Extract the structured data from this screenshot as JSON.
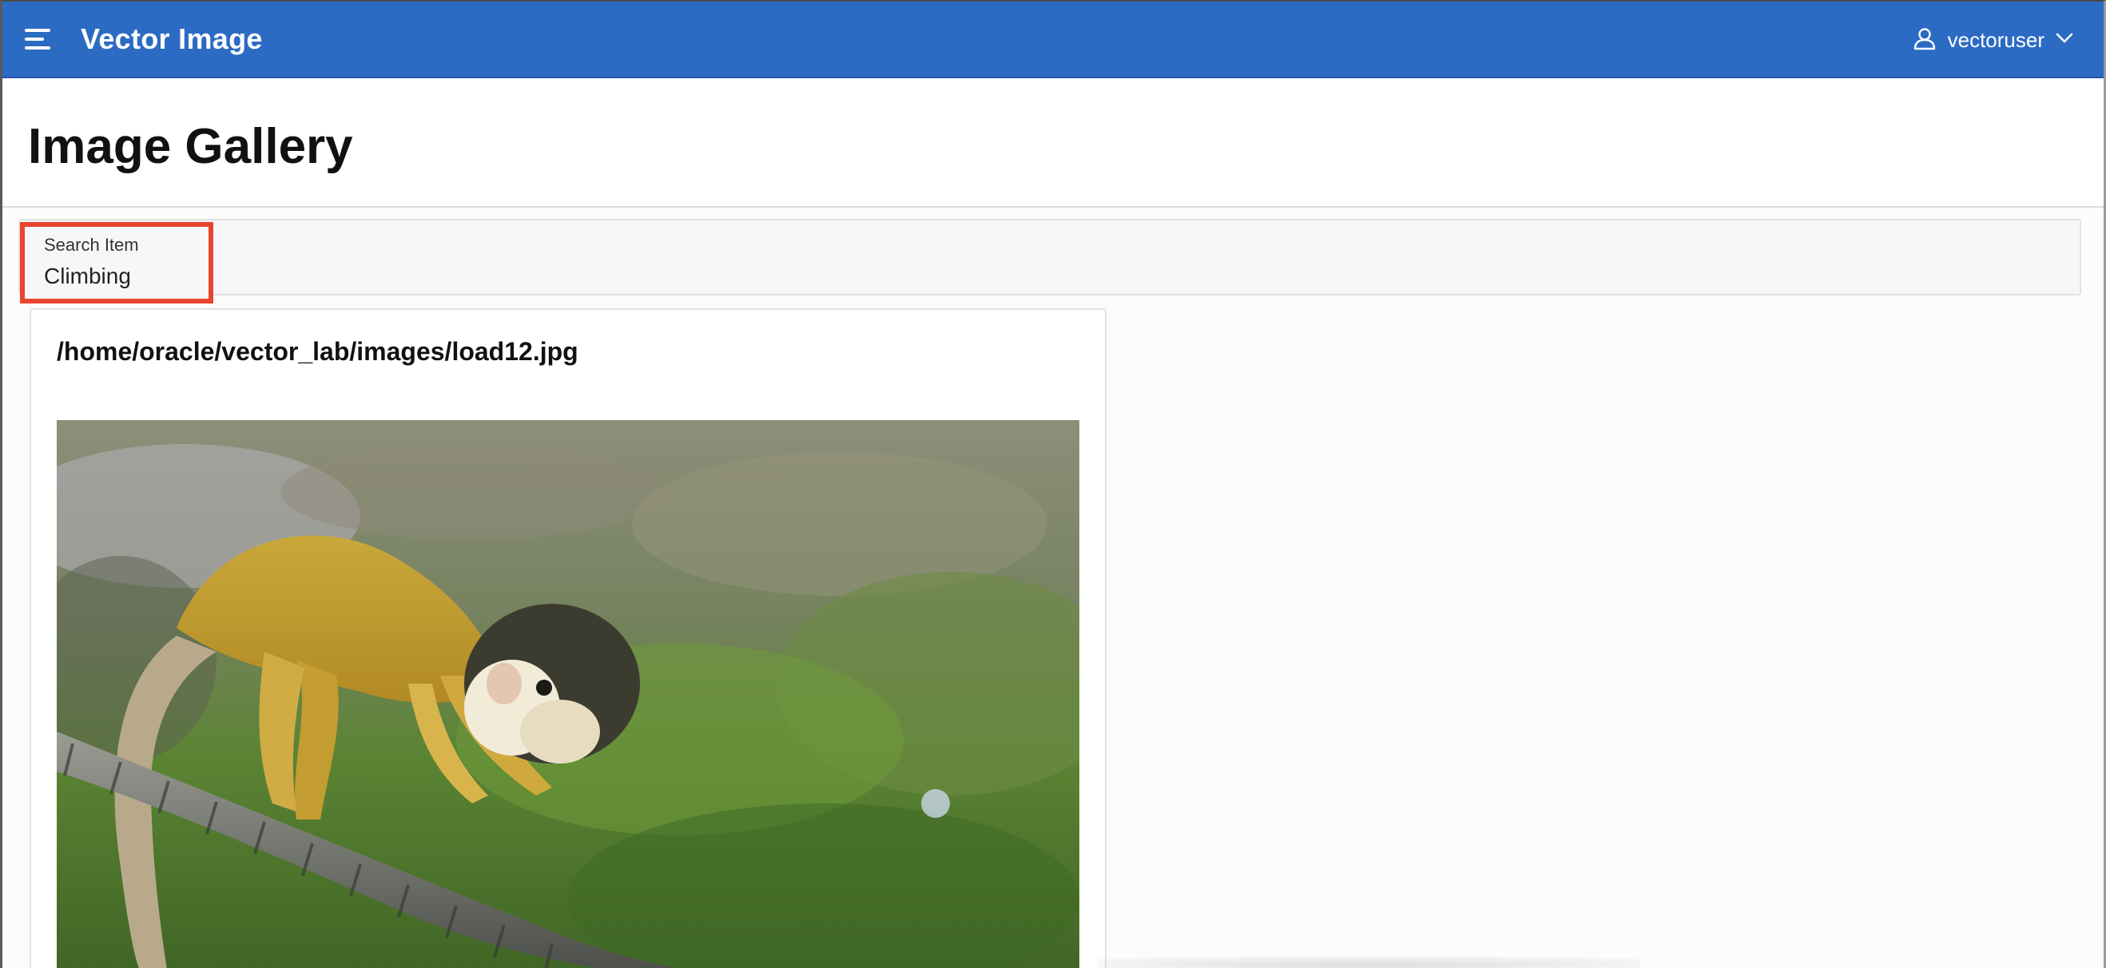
{
  "header": {
    "app_title": "Vector Image",
    "menu_icon": "hamburger-menu-icon",
    "user_icon": "user-icon",
    "username": "vectoruser",
    "chevron_icon": "chevron-down-icon"
  },
  "page": {
    "title": "Image Gallery"
  },
  "search": {
    "label": "Search Item",
    "value": "Climbing",
    "highlight_color": "#e8452f"
  },
  "gallery": {
    "cards": [
      {
        "title": "/home/oracle/vector_lab/images/load12.jpg",
        "image_alt": "squirrel monkey climbing on a rope"
      }
    ]
  },
  "colors": {
    "header_bg": "#2c6bc4",
    "header_text": "#ffffff",
    "page_bg": "#fcfcfc"
  }
}
